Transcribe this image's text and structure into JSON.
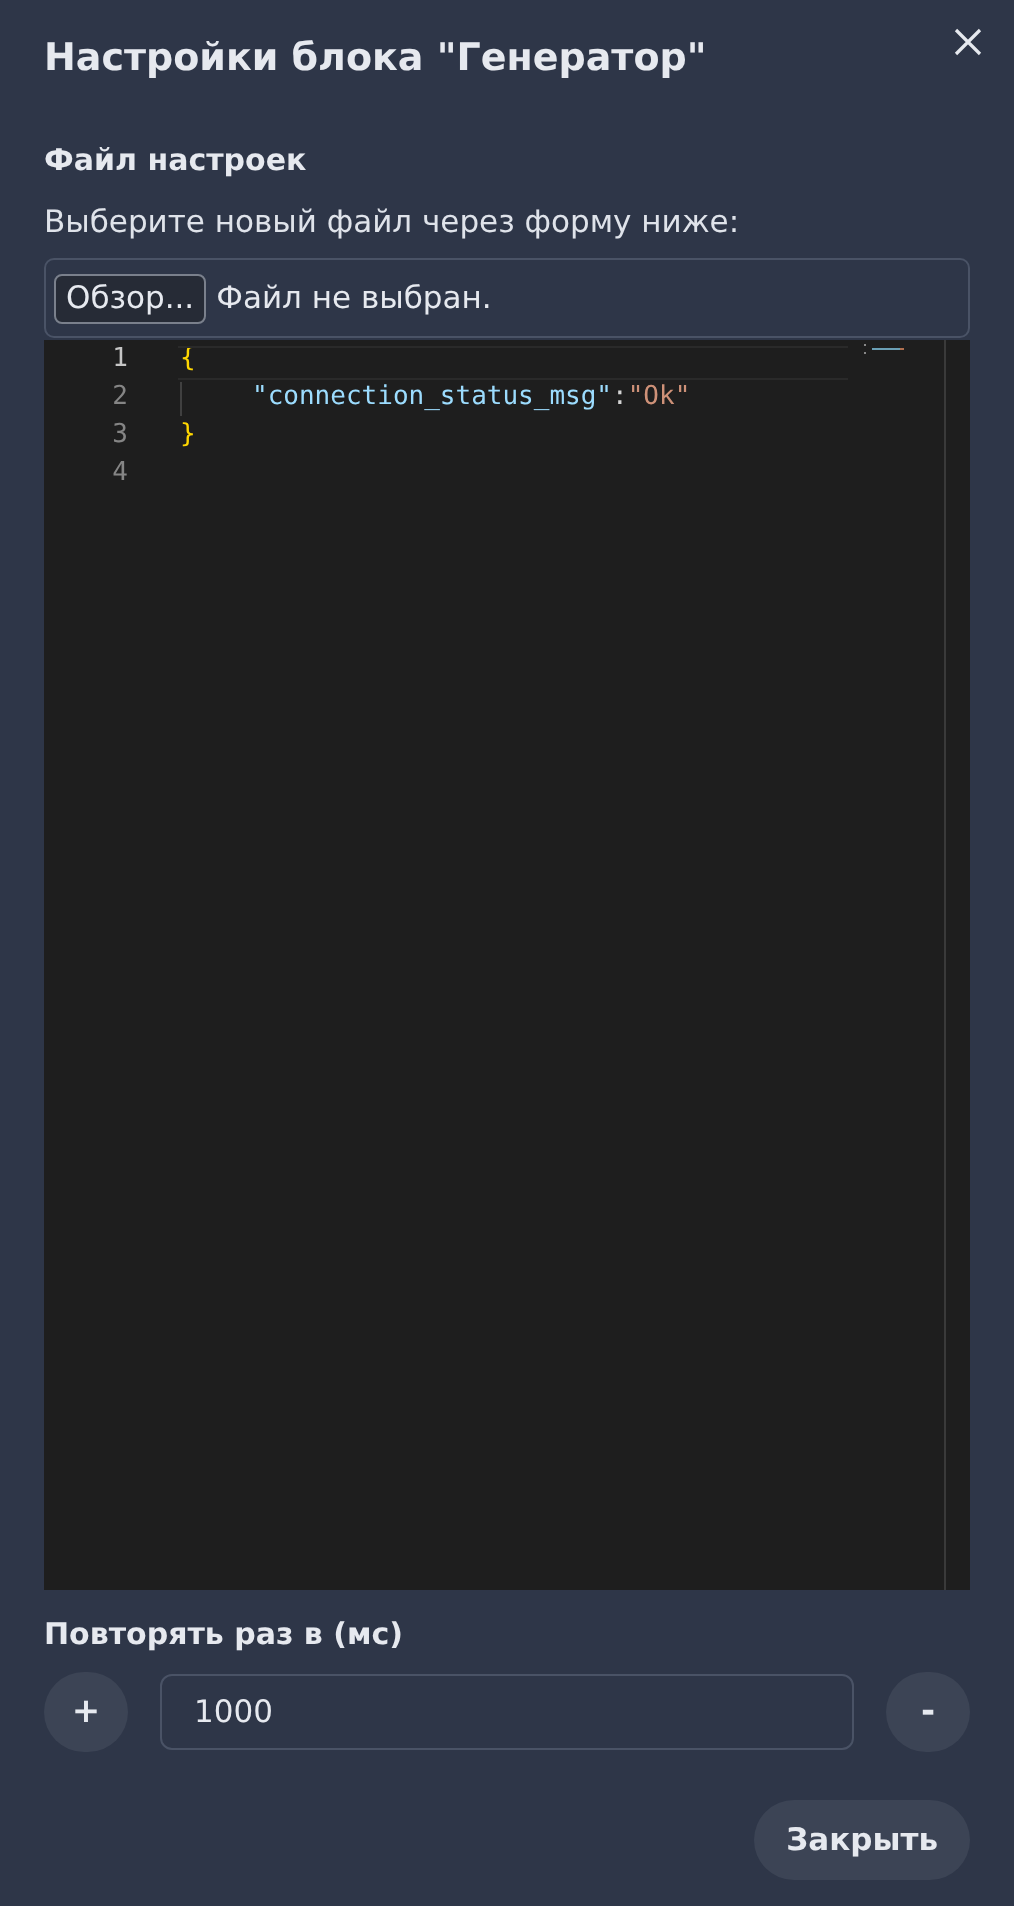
{
  "dialog": {
    "title": "Настройки блока \"Генератор\""
  },
  "settings_file": {
    "heading": "Файл настроек",
    "description": "Выберите новый файл через форму ниже:",
    "browse_button": "Обзор...",
    "file_status": "Файл не выбран."
  },
  "editor": {
    "lines": [
      {
        "number": "1",
        "active": true,
        "tokens": [
          {
            "kind": "brace",
            "text": "{"
          }
        ]
      },
      {
        "number": "2",
        "active": false,
        "tokens": [
          {
            "kind": "key",
            "text": "\"connection_status_msg\""
          },
          {
            "kind": "punct",
            "text": ":"
          },
          {
            "kind": "string",
            "text": "\"Ok\""
          }
        ]
      },
      {
        "number": "3",
        "active": false,
        "tokens": [
          {
            "kind": "brace",
            "text": "}"
          }
        ]
      },
      {
        "number": "4",
        "active": false
      }
    ]
  },
  "repeat": {
    "label": "Повторять раз в (мс)",
    "increment": "+",
    "value": "1000",
    "decrement": "-"
  },
  "buttons": {
    "close": "Закрыть"
  }
}
